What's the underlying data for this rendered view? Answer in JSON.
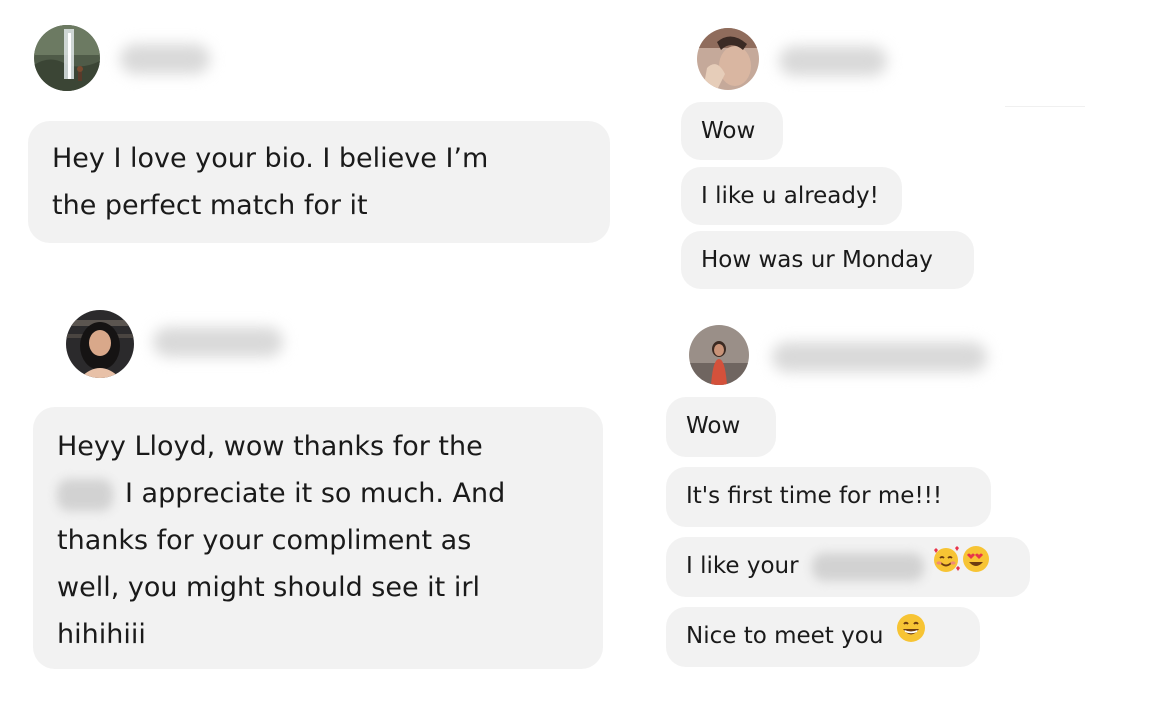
{
  "conversations": [
    {
      "avatar_icon": "waterfall-photo-avatar-icon",
      "messages": [
        {
          "lines": [
            "Hey I love your bio. I believe I’m",
            "the perfect match for it"
          ]
        }
      ]
    },
    {
      "avatar_icon": "woman-portrait-avatar-icon",
      "messages": [
        {
          "lines": [
            "Heyy Lloyd, wow thanks for the",
            "I appreciate it so much. And",
            "thanks for your compliment as",
            "well, you might should see it irl",
            "hihihiii"
          ]
        }
      ]
    },
    {
      "avatar_icon": "person-photo-avatar-icon",
      "messages": [
        {
          "text": "Wow"
        },
        {
          "text": "I like u already!"
        },
        {
          "text": "How was ur Monday"
        }
      ]
    },
    {
      "avatar_icon": "person-standing-avatar-icon",
      "messages": [
        {
          "text": "Wow"
        },
        {
          "text": "It's first time for me!!!"
        },
        {
          "text": "I like your"
        },
        {
          "text": "Nice to meet you"
        }
      ]
    }
  ],
  "emojis": {
    "smiling_face_with_hearts": "smiling-face-with-hearts-icon",
    "heart_eyes": "heart-eyes-icon",
    "grinning_face": "grinning-face-icon"
  },
  "colors": {
    "bubble_background": "#f2f2f2",
    "text": "#1a1a1a",
    "page_background": "#ffffff"
  }
}
